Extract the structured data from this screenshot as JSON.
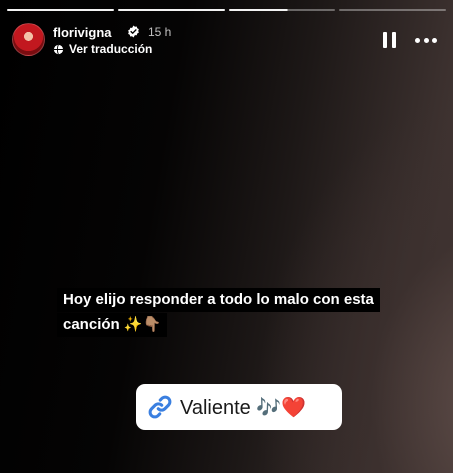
{
  "story": {
    "username": "florivigna",
    "time_ago": "15 h",
    "translate_label": "Ver traducción",
    "caption_line1": "Hoy elijo responder a todo lo malo con esta",
    "caption_line2": "canción ✨👇🏽",
    "link_label": "Valiente 🎶❤️",
    "progress_segments": 4,
    "active_segment": 2,
    "active_progress": 0.55
  },
  "icons": {
    "verified": "verified-badge-icon",
    "globe": "globe-icon",
    "pause": "pause-icon",
    "more": "more-options-icon",
    "link": "link-icon"
  },
  "colors": {
    "link_blue": "#3a7fe0",
    "caption_bg": "#000000",
    "avatar_red": "#c2181f"
  }
}
